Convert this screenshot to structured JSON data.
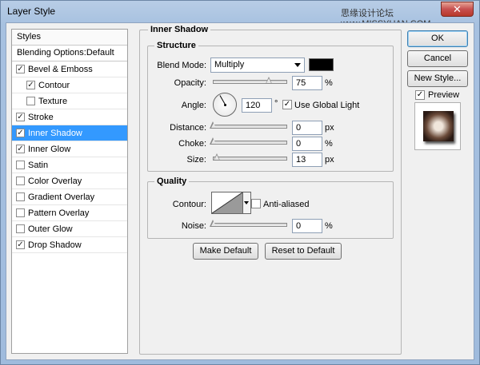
{
  "window": {
    "title": "Layer Style",
    "watermark": "思缘设计论坛  www.MISSYUAN.COM",
    "close_glyph": "✕"
  },
  "styles_panel": {
    "header": "Styles",
    "blending": "Blending Options:Default",
    "items": [
      {
        "label": "Bevel & Emboss",
        "checked": true,
        "level": 1,
        "selected": false
      },
      {
        "label": "Contour",
        "checked": true,
        "level": 2,
        "selected": false
      },
      {
        "label": "Texture",
        "checked": false,
        "level": 2,
        "selected": false
      },
      {
        "label": "Stroke",
        "checked": true,
        "level": 1,
        "selected": false
      },
      {
        "label": "Inner Shadow",
        "checked": true,
        "level": 1,
        "selected": true
      },
      {
        "label": "Inner Glow",
        "checked": true,
        "level": 1,
        "selected": false
      },
      {
        "label": "Satin",
        "checked": false,
        "level": 1,
        "selected": false
      },
      {
        "label": "Color Overlay",
        "checked": false,
        "level": 1,
        "selected": false
      },
      {
        "label": "Gradient Overlay",
        "checked": false,
        "level": 1,
        "selected": false
      },
      {
        "label": "Pattern Overlay",
        "checked": false,
        "level": 1,
        "selected": false
      },
      {
        "label": "Outer Glow",
        "checked": false,
        "level": 1,
        "selected": false
      },
      {
        "label": "Drop Shadow",
        "checked": true,
        "level": 1,
        "selected": false
      }
    ]
  },
  "inner_shadow": {
    "section_title": "Inner Shadow",
    "structure": {
      "title": "Structure",
      "blend_mode_label": "Blend Mode:",
      "blend_mode_value": "Multiply",
      "shadow_color": "#000000",
      "opacity_label": "Opacity:",
      "opacity_value": "75",
      "opacity_unit": "%",
      "opacity_level": 0.75,
      "angle_label": "Angle:",
      "angle_value": "120",
      "angle_unit": "°",
      "use_global_light_label": "Use Global Light",
      "use_global_light": true,
      "distance_label": "Distance:",
      "distance_value": "0",
      "distance_unit": "px",
      "distance_level": 0,
      "choke_label": "Choke:",
      "choke_value": "0",
      "choke_unit": "%",
      "choke_level": 0,
      "size_label": "Size:",
      "size_value": "13",
      "size_unit": "px",
      "size_level": 0.05
    },
    "quality": {
      "title": "Quality",
      "contour_label": "Contour:",
      "anti_aliased_label": "Anti-aliased",
      "anti_aliased": false,
      "noise_label": "Noise:",
      "noise_value": "0",
      "noise_unit": "%",
      "noise_level": 0
    },
    "make_default": "Make Default",
    "reset_default": "Reset to Default"
  },
  "actions": {
    "ok": "OK",
    "cancel": "Cancel",
    "new_style": "New Style...",
    "preview_label": "Preview",
    "preview_checked": true
  }
}
